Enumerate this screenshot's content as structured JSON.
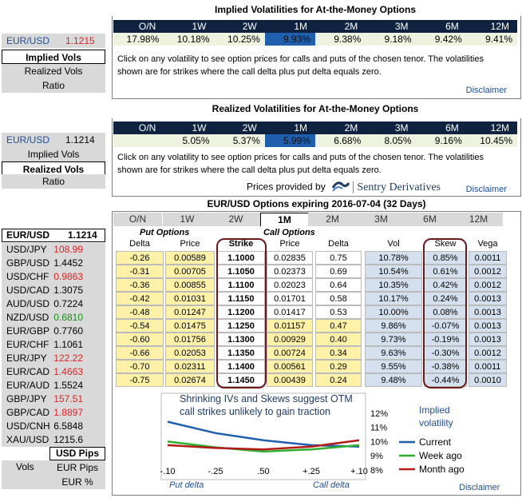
{
  "implied": {
    "title": "Implied Volatilities for At-the-Money Options",
    "tenors": [
      "O/N",
      "1W",
      "2W",
      "1M",
      "2M",
      "3M",
      "6M",
      "12M"
    ],
    "values": [
      "17.98%",
      "10.18%",
      "10.25%",
      "9.93%",
      "9.38%",
      "9.18%",
      "9.42%",
      "9.41%"
    ],
    "note": "Click on any volatility to see option prices for calls and puts of the chosen tenor. The volatilities shown are for strikes where the call delta plus put delta equals zero.",
    "disclaimer": "Disclaimer"
  },
  "realized": {
    "title": "Realized Volatilities for At-the-Money Options",
    "tenors": [
      "O/N",
      "1W",
      "2W",
      "1M",
      "2M",
      "3M",
      "6M",
      "12M"
    ],
    "values": [
      "",
      "5.05%",
      "5.37%",
      "5.99%",
      "6.68%",
      "8.05%",
      "9.16%",
      "10.45%"
    ],
    "note": "Click on any volatility to see option prices for calls and puts of the chosen tenor. The volatilities shown are for strikes where the call delta plus put delta equals zero.",
    "provided_by": "Prices provided by",
    "provider": "Sentry Derivatives",
    "disclaimer": "Disclaimer"
  },
  "left_top": {
    "pair": "EUR/USD",
    "rate": "1.1215",
    "buttons": [
      "Implied Vols",
      "Realized Vols",
      "Ratio"
    ]
  },
  "left_mid": {
    "pair": "EUR/USD",
    "rate": "1.1214",
    "buttons": [
      "Implied Vols",
      "Realized Vols",
      "Ratio"
    ]
  },
  "options": {
    "title": "EUR/USD Options expiring 2016-07-04 (32 Days)",
    "tabs": [
      "O/N",
      "1W",
      "2W",
      "1M",
      "2M",
      "3M",
      "6M",
      "12M"
    ],
    "selected_tab": "1M",
    "put_header": "Put Options",
    "call_header": "Call Options",
    "columns": [
      "Delta",
      "Price",
      "Strike",
      "Price",
      "Delta",
      "Vol",
      "Skew",
      "Vega"
    ],
    "rows": [
      [
        "-0.26",
        "0.00589",
        "1.1000",
        "0.02835",
        "0.75",
        "10.78%",
        "0.85%",
        "0.0011"
      ],
      [
        "-0.31",
        "0.00705",
        "1.1050",
        "0.02373",
        "0.69",
        "10.54%",
        "0.61%",
        "0.0012"
      ],
      [
        "-0.36",
        "0.00855",
        "1.1100",
        "0.02023",
        "0.64",
        "10.35%",
        "0.42%",
        "0.0012"
      ],
      [
        "-0.42",
        "0.01031",
        "1.1150",
        "0.01701",
        "0.58",
        "10.17%",
        "0.24%",
        "0.0013"
      ],
      [
        "-0.48",
        "0.01247",
        "1.1200",
        "0.01417",
        "0.53",
        "10.00%",
        "0.08%",
        "0.0013"
      ],
      [
        "-0.54",
        "0.01475",
        "1.1250",
        "0.01157",
        "0.47",
        "9.86%",
        "-0.07%",
        "0.0013"
      ],
      [
        "-0.60",
        "0.01756",
        "1.1300",
        "0.00929",
        "0.40",
        "9.73%",
        "-0.19%",
        "0.0013"
      ],
      [
        "-0.66",
        "0.02053",
        "1.1350",
        "0.00724",
        "0.34",
        "9.63%",
        "-0.30%",
        "0.0012"
      ],
      [
        "-0.70",
        "0.02311",
        "1.1400",
        "0.00561",
        "0.29",
        "9.55%",
        "-0.38%",
        "0.0011"
      ],
      [
        "-0.75",
        "0.02674",
        "1.1450",
        "0.00439",
        "0.24",
        "9.48%",
        "-0.44%",
        "0.0010"
      ]
    ],
    "disclaimer": "Disclaimer"
  },
  "fx": {
    "pair": "EUR/USD",
    "rate": "1.1214",
    "rows": [
      {
        "n": "USD/JPY",
        "v": "108.99",
        "c": "red"
      },
      {
        "n": "GBP/USD",
        "v": "1.4452",
        "c": "blk"
      },
      {
        "n": "USD/CHF",
        "v": "0.9863",
        "c": "red"
      },
      {
        "n": "USD/CAD",
        "v": "1.3075",
        "c": "blk"
      },
      {
        "n": "AUD/USD",
        "v": "0.7224",
        "c": "blk"
      },
      {
        "n": "NZD/USD",
        "v": "0.6810",
        "c": "grn"
      },
      {
        "n": "EUR/GBP",
        "v": "0.7760",
        "c": "blk"
      },
      {
        "n": "EUR/CHF",
        "v": "1.1061",
        "c": "blk"
      },
      {
        "n": "EUR/JPY",
        "v": "122.22",
        "c": "red"
      },
      {
        "n": "EUR/CAD",
        "v": "1.4663",
        "c": "red"
      },
      {
        "n": "EUR/AUD",
        "v": "1.5524",
        "c": "blk"
      },
      {
        "n": "GBP/JPY",
        "v": "157.51",
        "c": "red"
      },
      {
        "n": "GBP/CAD",
        "v": "1.8897",
        "c": "red"
      },
      {
        "n": "USD/CNH",
        "v": "6.5848",
        "c": "blk"
      },
      {
        "n": "XAU/USD",
        "v": "1215.6",
        "c": "blk"
      }
    ],
    "pips_label": "USD Pips",
    "vols_label": "Vols",
    "eur_pips": "EUR Pips",
    "eur_pct": "EUR %"
  },
  "chart_data": {
    "type": "line",
    "annotation": "Shrinking IVs and Skews suggest OTM call strikes unlikely to gain traction",
    "x_ticks": [
      "-.10",
      "-.25",
      ".50",
      "+.25",
      "+.10"
    ],
    "y_ticks": [
      "12%",
      "11%",
      "10%",
      "9%",
      "8%"
    ],
    "ylim": [
      8,
      12.5
    ],
    "legend_title": "Implied volatility",
    "series": [
      {
        "name": "Current",
        "color": "#1f5fae",
        "values": [
          11.4,
          10.6,
          10.1,
          9.75,
          9.65
        ]
      },
      {
        "name": "Week ago",
        "color": "#2fae2f",
        "values": [
          10.0,
          9.6,
          9.3,
          9.45,
          9.75
        ]
      },
      {
        "name": "Month ago",
        "color": "#b31b1b",
        "values": [
          9.75,
          9.55,
          9.45,
          9.65,
          10.1
        ]
      }
    ],
    "put_label": "Put delta",
    "call_label": "Call delta"
  }
}
